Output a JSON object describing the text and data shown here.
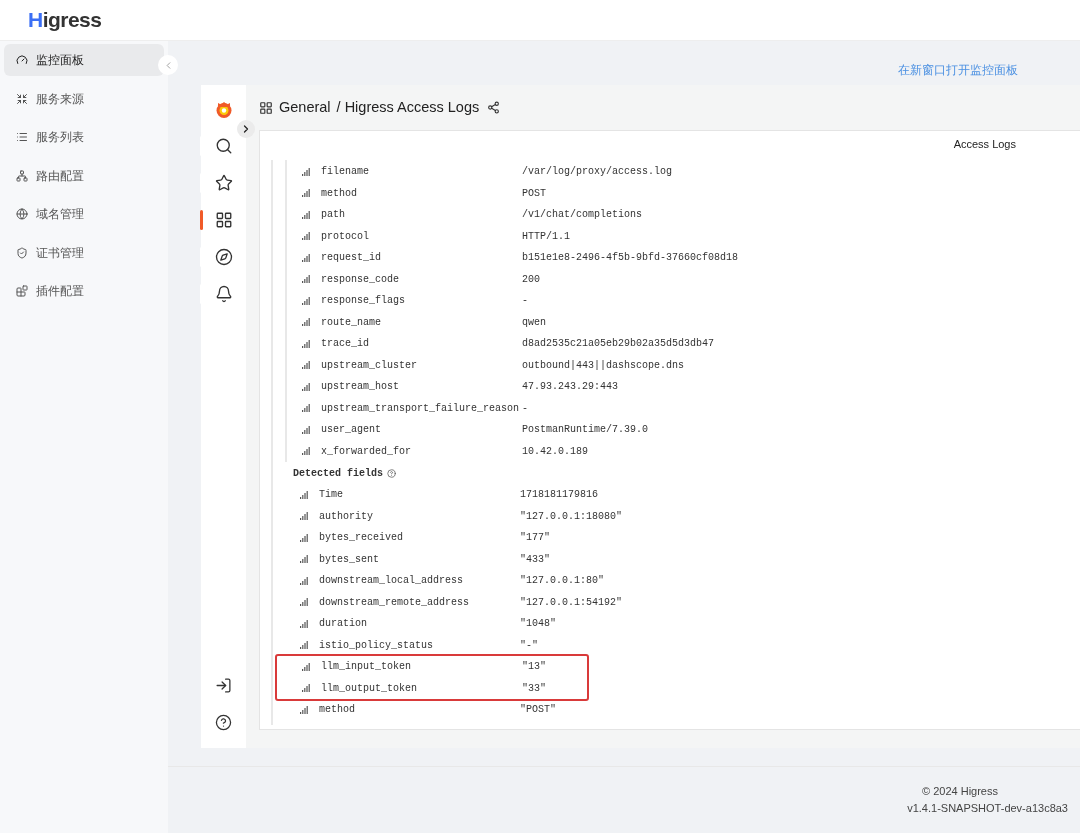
{
  "logo": "Higress",
  "sidebar": {
    "items": [
      {
        "label": "监控面板",
        "selected": true
      },
      {
        "label": "服务来源",
        "selected": false
      },
      {
        "label": "服务列表",
        "selected": false
      },
      {
        "label": "路由配置",
        "selected": false
      },
      {
        "label": "域名管理",
        "selected": false
      },
      {
        "label": "证书管理",
        "selected": false
      },
      {
        "label": "插件配置",
        "selected": false
      }
    ]
  },
  "open_link": "在新窗口打开监控面板",
  "grafana": {
    "nav": [
      {
        "selected": false
      },
      {
        "selected": false
      },
      {
        "selected": true
      },
      {
        "selected": false
      },
      {
        "selected": false
      }
    ],
    "breadcrumb": "General",
    "dashboard_title": "/ Higress Access Logs",
    "panel_title": "Access Logs",
    "fields": [
      {
        "name": "filename",
        "value": "/var/log/proxy/access.log",
        "highlighted": false
      },
      {
        "name": "method",
        "value": "POST",
        "highlighted": false
      },
      {
        "name": "path",
        "value": "/v1/chat/completions",
        "highlighted": false
      },
      {
        "name": "protocol",
        "value": "HTTP/1.1",
        "highlighted": false
      },
      {
        "name": "request_id",
        "value": "b151e1e8-2496-4f5b-9bfd-37660cf08d18",
        "highlighted": false
      },
      {
        "name": "response_code",
        "value": "200",
        "highlighted": false
      },
      {
        "name": "response_flags",
        "value": "-",
        "highlighted": false
      },
      {
        "name": "route_name",
        "value": "qwen",
        "highlighted": false
      },
      {
        "name": "trace_id",
        "value": "d8ad2535c21a05eb29b02a35d5d3db47",
        "highlighted": false
      },
      {
        "name": "upstream_cluster",
        "value": "outbound|443||dashscope.dns",
        "highlighted": false
      },
      {
        "name": "upstream_host",
        "value": "47.93.243.29:443",
        "highlighted": false
      },
      {
        "name": "upstream_transport_failure_reason",
        "value": "-",
        "highlighted": false
      },
      {
        "name": "user_agent",
        "value": "PostmanRuntime/7.39.0",
        "highlighted": false
      },
      {
        "name": "x_forwarded_for",
        "value": "10.42.0.189",
        "highlighted": false
      }
    ],
    "detected_heading": "Detected fields",
    "detected_fields": [
      {
        "name": "Time",
        "value": "1718181179816",
        "highlighted": false
      },
      {
        "name": "authority",
        "value": "\"127.0.0.1:18080\"",
        "highlighted": false
      },
      {
        "name": "bytes_received",
        "value": "\"177\"",
        "highlighted": false
      },
      {
        "name": "bytes_sent",
        "value": "\"433\"",
        "highlighted": false
      },
      {
        "name": "downstream_local_address",
        "value": "\"127.0.0.1:80\"",
        "highlighted": false
      },
      {
        "name": "downstream_remote_address",
        "value": "\"127.0.0.1:54192\"",
        "highlighted": false
      },
      {
        "name": "duration",
        "value": "\"1048\"",
        "highlighted": false
      },
      {
        "name": "istio_policy_status",
        "value": "\"-\"",
        "highlighted": false
      },
      {
        "name": "llm_input_token",
        "value": "\"13\"",
        "highlighted": true
      },
      {
        "name": "llm_output_token",
        "value": "\"33\"",
        "highlighted": true
      },
      {
        "name": "method",
        "value": "\"POST\"",
        "highlighted": false
      }
    ]
  },
  "footer": {
    "copyright": "© 2024 Higress",
    "version": "v1.4.1-SNAPSHOT-dev-a13c8a3"
  }
}
